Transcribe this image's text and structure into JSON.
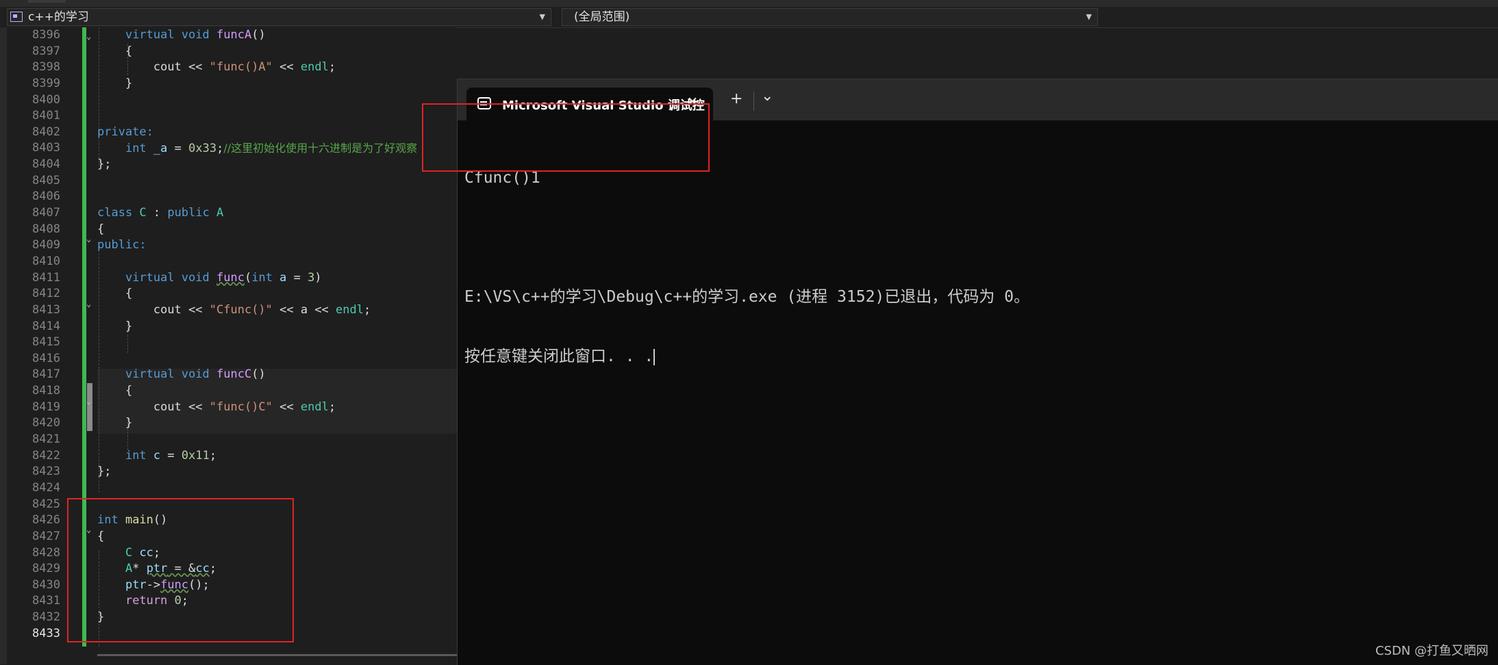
{
  "navbar": {
    "project": "c++的学习",
    "scope": "(全局范围)"
  },
  "editor": {
    "line_numbers": [
      "8396",
      "8397",
      "8398",
      "8399",
      "8400",
      "8401",
      "8402",
      "8403",
      "8404",
      "8405",
      "8406",
      "8407",
      "8408",
      "8409",
      "8410",
      "8411",
      "8412",
      "8413",
      "8414",
      "8415",
      "8416",
      "8417",
      "8418",
      "8419",
      "8420",
      "8421",
      "8422",
      "8423",
      "8424",
      "8425",
      "8426",
      "8427",
      "8428",
      "8429",
      "8430",
      "8431",
      "8432",
      "8433"
    ],
    "code": {
      "l8396_kw": "virtual void ",
      "l8396_fn": "funcA",
      "l8396_rest": "()",
      "l8397": "{",
      "l8398_a": "cout << ",
      "l8398_str": "\"func()A\"",
      "l8398_b": " << ",
      "l8398_endl": "endl",
      "l8398_c": ";",
      "l8399": "}",
      "l8402": "private:",
      "l8403_kw": "int ",
      "l8403_var": "_a",
      "l8403_eq": " = ",
      "l8403_num": "0x33",
      "l8403_semi": ";",
      "l8403_cmt": "//这里初始化使用十六进制是为了好观察",
      "l8404": "};",
      "l8407_kw": "class ",
      "l8407_ty": "C",
      "l8407_mid": " : ",
      "l8407_kw2": "public ",
      "l8407_ty2": "A",
      "l8408": "{",
      "l8409": "public:",
      "l8411_kw": "virtual void ",
      "l8411_fn": "func",
      "l8411_p": "(",
      "l8411_kw2": "int ",
      "l8411_var": "a",
      "l8411_eq": " = ",
      "l8411_num": "3",
      "l8411_end": ")",
      "l8412": "{",
      "l8413_a": "cout << ",
      "l8413_str": "\"Cfunc()\"",
      "l8413_b": " << a << ",
      "l8413_endl": "endl",
      "l8413_c": ";",
      "l8414": "}",
      "l8417_kw": "virtual void ",
      "l8417_fn": "funcC",
      "l8417_rest": "()",
      "l8418": "{",
      "l8419_a": "cout << ",
      "l8419_str": "\"func()C\"",
      "l8419_b": " << ",
      "l8419_endl": "endl",
      "l8419_c": ";",
      "l8420": "}",
      "l8422_kw": "int ",
      "l8422_var": "c",
      "l8422_eq": " = ",
      "l8422_num": "0x11",
      "l8422_semi": ";",
      "l8423": "};",
      "l8426_kw": "int ",
      "l8426_fn": "main",
      "l8426_rest": "()",
      "l8427": "{",
      "l8428_ty": "C ",
      "l8428_var": "cc",
      "l8428_semi": ";",
      "l8429_ty": "A",
      "l8429_star": "* ",
      "l8429_var": "ptr",
      "l8429_rest": " = &",
      "l8429_var2": "cc",
      "l8429_semi": ";",
      "l8430_var": "ptr",
      "l8430_arrow": "->",
      "l8430_fn": "func",
      "l8430_rest": "();",
      "l8431_kw": "return ",
      "l8431_num": "0",
      "l8431_semi": ";",
      "l8432": "}"
    }
  },
  "terminal": {
    "tab_title": "Microsoft Visual Studio 调试控",
    "tab_close": "✕",
    "new_tab": "+",
    "dropdown": "⌄",
    "output_line1": "Cfunc()1",
    "output_line2": "",
    "output_line3": "E:\\VS\\c++的学习\\Debug\\c++的学习.exe (进程 3152)已退出，代码为 0。",
    "output_line4": "按任意键关闭此窗口. . ."
  },
  "watermark": "CSDN @打鱼又晒网",
  "colors": {
    "editor_bg": "#1e1e1e",
    "terminal_bg": "#0c0c0c",
    "change_bar": "#3fb950",
    "annotation_red": "#e02424"
  }
}
